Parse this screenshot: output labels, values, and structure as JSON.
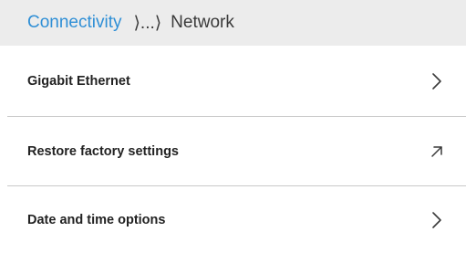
{
  "breadcrumb": {
    "parent": "Connectivity",
    "separator": "⟩...⟩",
    "current": "Network"
  },
  "items": [
    {
      "label": "Gigabit Ethernet",
      "icon": "chevron-right-icon"
    },
    {
      "label": "Restore factory settings",
      "icon": "arrow-up-right-icon"
    },
    {
      "label": "Date and time options",
      "icon": "chevron-right-icon"
    }
  ],
  "colors": {
    "header_bg": "#ececec",
    "link": "#2f8fd6",
    "text": "#222222",
    "divider": "#c9c9c9"
  }
}
